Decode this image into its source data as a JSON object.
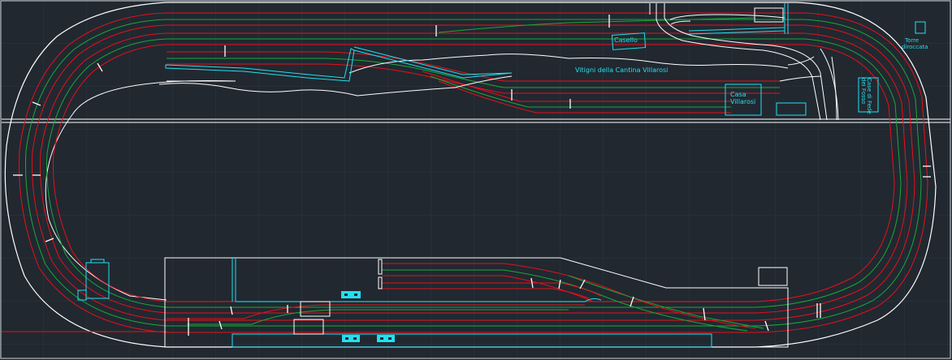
{
  "drawing": {
    "background": "#212830",
    "colors": {
      "track_outer": "#e8101a",
      "track_center": "#19a83a",
      "outline": "#ffffff",
      "building": "#22e0f0",
      "grid": "#2c3640"
    }
  },
  "labels": {
    "casello": "Casello",
    "vigneti": "Vitigni della Cantina Villarosi",
    "casa_1": "Casa",
    "casa_2": "Villarosi",
    "torre_1": "Torre",
    "torre_2": "diroccata",
    "side_1": "Case di Fede",
    "side_2": "dei Fosso"
  }
}
